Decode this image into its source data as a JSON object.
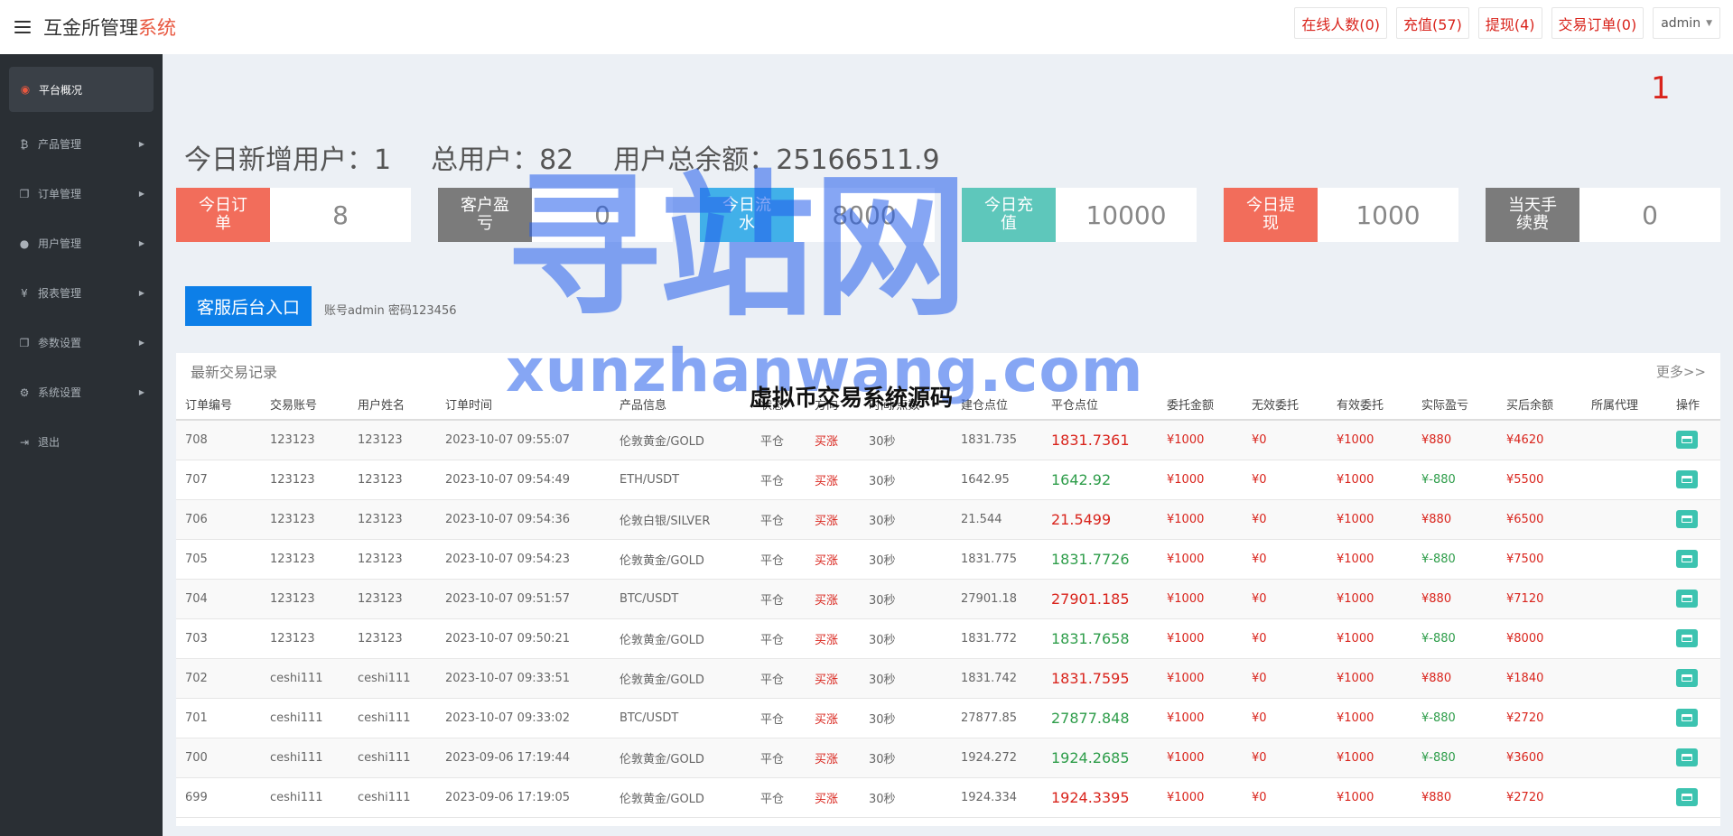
{
  "header": {
    "brand_main": "互金所管理",
    "brand_accent": "系统",
    "buttons": [
      "在线人数(0)",
      "充值(57)",
      "提现(4)",
      "交易订单(0)"
    ],
    "admin": "admin"
  },
  "sidebar": {
    "items": [
      {
        "label": "平台概况",
        "icon": "dashboard-icon",
        "glyph": "◉"
      },
      {
        "label": "产品管理",
        "icon": "bitcoin-icon",
        "glyph": "₿"
      },
      {
        "label": "订单管理",
        "icon": "copy-icon",
        "glyph": "❐"
      },
      {
        "label": "用户管理",
        "icon": "user-icon",
        "glyph": "👤"
      },
      {
        "label": "报表管理",
        "icon": "yen-icon",
        "glyph": "¥"
      },
      {
        "label": "参数设置",
        "icon": "copy-icon",
        "glyph": "❐"
      },
      {
        "label": "系统设置",
        "icon": "gears-icon",
        "glyph": "⚙"
      },
      {
        "label": "退出",
        "icon": "sign-out-icon",
        "glyph": "⇥"
      }
    ]
  },
  "main": {
    "indicator": "1",
    "stats": {
      "new_users": "今日新增用户：1",
      "total_users": "总用户：82",
      "total_balance": "用户总余额：25166511.9"
    },
    "cards": [
      {
        "label": "今日订单",
        "value": "8",
        "color": "#f26d5b"
      },
      {
        "label": "客户盈亏",
        "value": "0",
        "color": "#7b7b7b"
      },
      {
        "label": "今日流水",
        "value": "8000",
        "color": "#41b0e9"
      },
      {
        "label": "今日充值",
        "value": "10000",
        "color": "#5ec7bb"
      },
      {
        "label": "今日提现",
        "value": "1000",
        "color": "#f26d5b"
      },
      {
        "label": "当天手续费",
        "value": "0",
        "color": "#7b7b7b"
      }
    ],
    "kefu_button": "客服后台入口",
    "kefu_note": "账号admin 密码123456"
  },
  "records": {
    "title": "最新交易记录",
    "more": "更多>>",
    "columns": [
      "订单编号",
      "交易账号",
      "用户姓名",
      "订单时间",
      "产品信息",
      "状态",
      "方向",
      "时间/点数",
      "建仓点位",
      "平仓点位",
      "委托金额",
      "无效委托",
      "有效委托",
      "实际盈亏",
      "买后余额",
      "所属代理",
      "操作"
    ],
    "rows": [
      [
        "708",
        "123123",
        "123123",
        "2023-10-07 09:55:07",
        "伦敦黄金/GOLD",
        "平仓",
        "买涨",
        "30秒",
        "1831.735",
        "1831.7361",
        "¥1000",
        "¥0",
        "¥1000",
        "¥880",
        "¥4620",
        ""
      ],
      [
        "707",
        "123123",
        "123123",
        "2023-10-07 09:54:49",
        "ETH/USDT",
        "平仓",
        "买涨",
        "30秒",
        "1642.95",
        "1642.92",
        "¥1000",
        "¥0",
        "¥1000",
        "¥-880",
        "¥5500",
        ""
      ],
      [
        "706",
        "123123",
        "123123",
        "2023-10-07 09:54:36",
        "伦敦白银/SILVER",
        "平仓",
        "买涨",
        "30秒",
        "21.544",
        "21.5499",
        "¥1000",
        "¥0",
        "¥1000",
        "¥880",
        "¥6500",
        ""
      ],
      [
        "705",
        "123123",
        "123123",
        "2023-10-07 09:54:23",
        "伦敦黄金/GOLD",
        "平仓",
        "买涨",
        "30秒",
        "1831.775",
        "1831.7726",
        "¥1000",
        "¥0",
        "¥1000",
        "¥-880",
        "¥7500",
        ""
      ],
      [
        "704",
        "123123",
        "123123",
        "2023-10-07 09:51:57",
        "BTC/USDT",
        "平仓",
        "买涨",
        "30秒",
        "27901.18",
        "27901.185",
        "¥1000",
        "¥0",
        "¥1000",
        "¥880",
        "¥7120",
        ""
      ],
      [
        "703",
        "123123",
        "123123",
        "2023-10-07 09:50:21",
        "伦敦黄金/GOLD",
        "平仓",
        "买涨",
        "30秒",
        "1831.772",
        "1831.7658",
        "¥1000",
        "¥0",
        "¥1000",
        "¥-880",
        "¥8000",
        ""
      ],
      [
        "702",
        "ceshi111",
        "ceshi111",
        "2023-10-07 09:33:51",
        "伦敦黄金/GOLD",
        "平仓",
        "买涨",
        "30秒",
        "1831.742",
        "1831.7595",
        "¥1000",
        "¥0",
        "¥1000",
        "¥880",
        "¥1840",
        ""
      ],
      [
        "701",
        "ceshi111",
        "ceshi111",
        "2023-10-07 09:33:02",
        "BTC/USDT",
        "平仓",
        "买涨",
        "30秒",
        "27877.85",
        "27877.848",
        "¥1000",
        "¥0",
        "¥1000",
        "¥-880",
        "¥2720",
        ""
      ],
      [
        "700",
        "ceshi111",
        "ceshi111",
        "2023-09-06 17:19:44",
        "伦敦黄金/GOLD",
        "平仓",
        "买涨",
        "30秒",
        "1924.272",
        "1924.2685",
        "¥1000",
        "¥0",
        "¥1000",
        "¥-880",
        "¥3600",
        ""
      ],
      [
        "699",
        "ceshi111",
        "ceshi111",
        "2023-09-06 17:19:05",
        "伦敦黄金/GOLD",
        "平仓",
        "买涨",
        "30秒",
        "1924.334",
        "1924.3395",
        "¥1000",
        "¥0",
        "¥1000",
        "¥880",
        "¥2720",
        ""
      ]
    ]
  },
  "watermark": {
    "text": "寻站网",
    "url": "xunzhanwang.com",
    "caption": "虚拟币交易系统源码"
  }
}
